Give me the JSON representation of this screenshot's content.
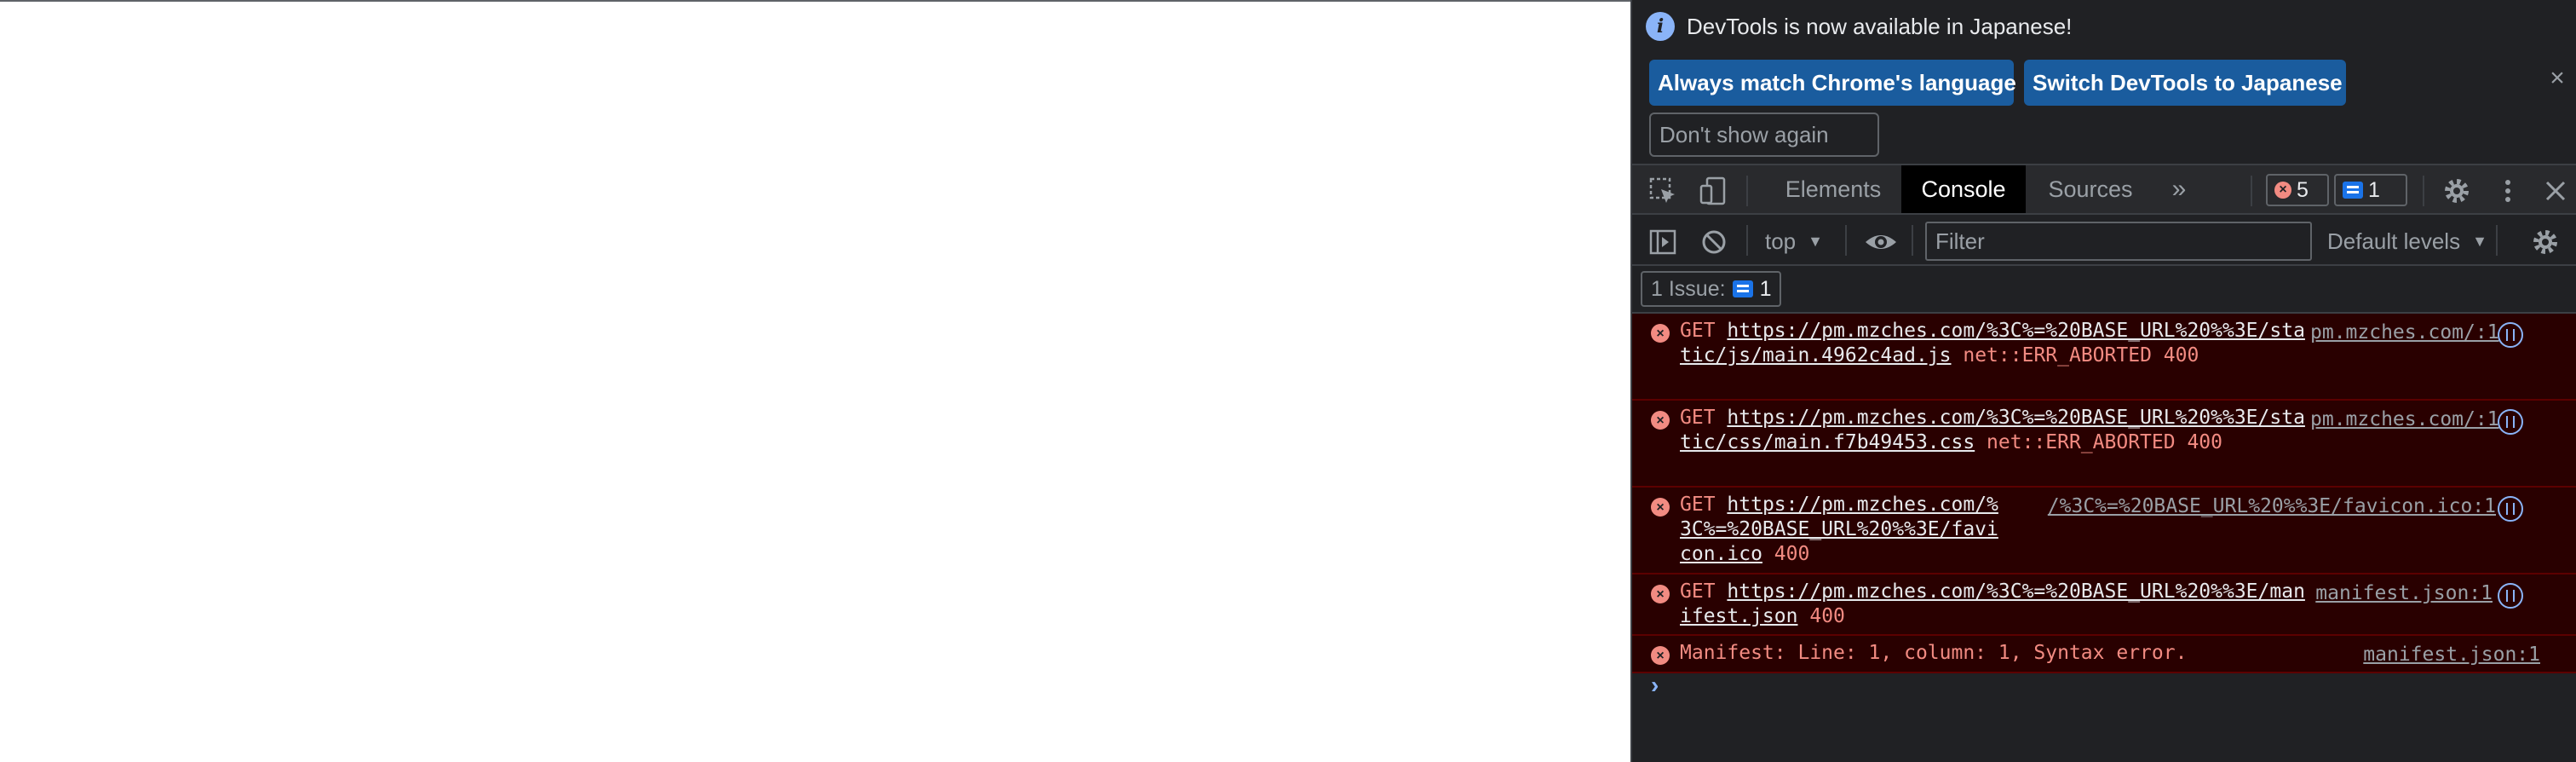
{
  "infobar": {
    "message": "DevTools is now available in Japanese!",
    "always_match": "Always match Chrome's language",
    "switch": "Switch DevTools to Japanese",
    "dont_show": "Don't show again",
    "close": "×"
  },
  "tabs": {
    "elements": "Elements",
    "console": "Console",
    "sources": "Sources",
    "more": "»"
  },
  "badges": {
    "errors": "5",
    "messages": "1"
  },
  "console_toolbar": {
    "context": "top",
    "filter_placeholder": "Filter",
    "levels": "Default levels"
  },
  "issues": {
    "label": "1 Issue:",
    "count": "1"
  },
  "messages": [
    {
      "method": "GET",
      "url": "https://pm.mzches.com/%3C%=%20BASE_URL%20%%3E/static/js/main.4962c4ad.js",
      "detail": "net::ERR_ABORTED 400",
      "source": "pm.mzches.com/:1"
    },
    {
      "method": "GET",
      "url": "https://pm.mzches.com/%3C%=%20BASE_URL%20%%3E/static/css/main.f7b49453.css",
      "detail": "net::ERR_ABORTED 400",
      "source": "pm.mzches.com/:1"
    },
    {
      "method": "GET",
      "url": "https://pm.mzches.com/%3C%=%20BASE_URL%20%%3E/favicon.ico",
      "detail": "400",
      "source": "/%3C%=%20BASE_URL%20%%3E/favicon.ico:1"
    },
    {
      "method": "GET",
      "url": "https://pm.mzches.com/%3C%=%20BASE_URL%20%%3E/manifest.json",
      "detail": "400",
      "source": "manifest.json:1"
    },
    {
      "text": "Manifest: Line: 1, column: 1, Syntax error.",
      "source": "manifest.json:1"
    }
  ],
  "colors": {
    "devtools_bg": "#202124",
    "error_bg": "#290000",
    "error_text": "#f28b82",
    "button_blue": "#1a5c9e",
    "accent": "#8ab4f8"
  }
}
